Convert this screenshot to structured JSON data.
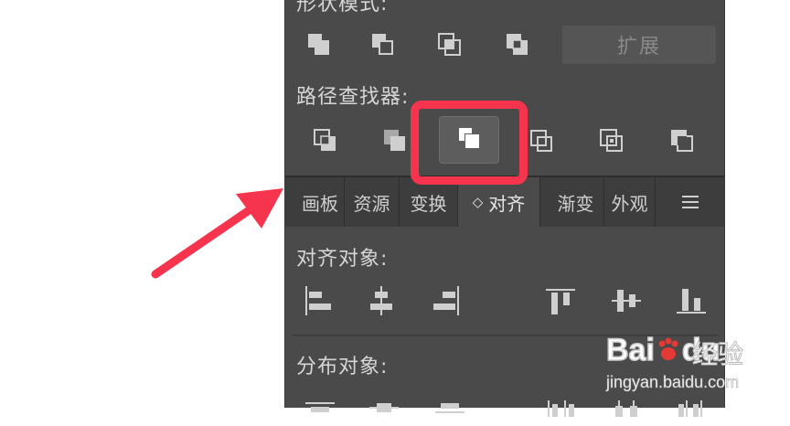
{
  "panel": {
    "shape_modes": {
      "title": "形状模式:",
      "icons": [
        "unite-icon",
        "minus-front-icon",
        "intersect-icon",
        "exclude-icon"
      ],
      "expand_label": "扩展"
    },
    "pathfinder": {
      "title": "路径查找器:",
      "icons": [
        "divide-icon",
        "trim-icon",
        "merge-icon",
        "crop-icon",
        "outline-icon",
        "minus-back-icon"
      ],
      "selected": "trim-icon"
    },
    "tabs": [
      {
        "label": "画板",
        "active": false
      },
      {
        "label": "资源",
        "active": false
      },
      {
        "label": "变换",
        "active": false
      },
      {
        "label": "对齐",
        "active": true
      },
      {
        "label": "渐变",
        "active": false
      },
      {
        "label": "外观",
        "active": false
      }
    ],
    "align_objects": {
      "title": "对齐对象:",
      "icons": [
        "align-left-icon",
        "align-h-center-icon",
        "align-right-icon",
        "align-top-icon",
        "align-v-center-icon",
        "align-bottom-icon"
      ]
    },
    "distribute_objects": {
      "title": "分布对象:"
    }
  },
  "watermark": {
    "brand": "Bai",
    "brand2": "du",
    "service": "经验",
    "url": "jingyan.baidu.com"
  },
  "colors": {
    "highlight": "#f7344e",
    "panel_bg": "#4a4a4a",
    "tab_bg": "#3d3d3d",
    "baidu_red": "#e53935"
  }
}
